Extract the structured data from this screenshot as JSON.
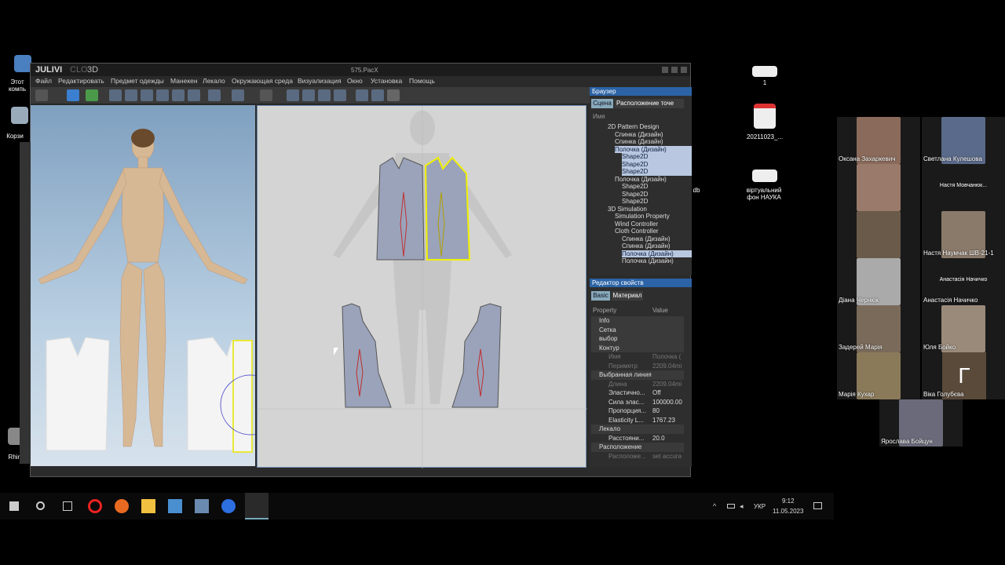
{
  "desktop": {
    "icons_left": [
      {
        "label": "Этот\nкомпь",
        "icon": "computer-icon"
      },
      {
        "label": "Корзи",
        "icon": "recycle-bin-icon"
      },
      {
        "label": "Rhino",
        "icon": "rhino-icon"
      }
    ],
    "icons_right": [
      {
        "label": "1",
        "icon": "file-icon"
      },
      {
        "label": "20211023_...",
        "icon": "pdf-icon"
      },
      {
        "label": "віртуальний\nфон НАУКА",
        "icon": "image-icon"
      }
    ],
    "partial_text": "db"
  },
  "app": {
    "logo": "JULIVI",
    "logo_suffix": "3D",
    "title": "575.PacX",
    "menu": [
      "Файл",
      "Редактировать",
      "Предмет одежды",
      "Манекен",
      "Лекало",
      "Окружающая среда",
      "Визуализация",
      "Окно",
      "Установка",
      "Помощь"
    ]
  },
  "browser": {
    "title": "Браузер",
    "tabs": [
      "Сцена",
      "Расположение точе"
    ],
    "header": "Имя",
    "tree": [
      {
        "label": "2D Pattern Design",
        "level": 1,
        "sel": false
      },
      {
        "label": "Спинка (Дизайн)",
        "level": 2,
        "sel": false
      },
      {
        "label": "Спинка (Дизайн)",
        "level": 2,
        "sel": false
      },
      {
        "label": "Полочка (Дизайн)",
        "level": 2,
        "sel": true
      },
      {
        "label": "Shape2D",
        "level": 3,
        "sel": true
      },
      {
        "label": "Shape2D",
        "level": 3,
        "sel": true
      },
      {
        "label": "Shape2D",
        "level": 3,
        "sel": true
      },
      {
        "label": "Полочка (Дизайн)",
        "level": 2,
        "sel": false
      },
      {
        "label": "Shape2D",
        "level": 3,
        "sel": false
      },
      {
        "label": "Shape2D",
        "level": 3,
        "sel": false
      },
      {
        "label": "Shape2D",
        "level": 3,
        "sel": false
      },
      {
        "label": "3D Simulation",
        "level": 1,
        "sel": false
      },
      {
        "label": "Simulation Property",
        "level": 2,
        "sel": false
      },
      {
        "label": "Wind Controller",
        "level": 2,
        "sel": false
      },
      {
        "label": "Cloth Controller",
        "level": 2,
        "sel": false
      },
      {
        "label": "Спинка (Дизайн)",
        "level": 3,
        "sel": false
      },
      {
        "label": "Спинка (Дизайн)",
        "level": 3,
        "sel": false
      },
      {
        "label": "Полочка (Дизайн)",
        "level": 3,
        "sel": true
      },
      {
        "label": "Полочка (Дизайн)",
        "level": 3,
        "sel": false
      }
    ]
  },
  "props": {
    "title": "Редактор свойств",
    "tabs": [
      "Basic",
      "Материал"
    ],
    "col_property": "Property",
    "col_value": "Value",
    "rows": [
      {
        "k": "Info",
        "v": "",
        "type": "grp"
      },
      {
        "k": "Сетка",
        "v": "",
        "type": "grp"
      },
      {
        "k": "выбор",
        "v": "",
        "type": "grp"
      },
      {
        "k": "Контур",
        "v": "",
        "type": "grp"
      },
      {
        "k": "Имя",
        "v": "Полочка (",
        "type": "dim"
      },
      {
        "k": "Периметр",
        "v": "2209.04mi",
        "type": "dim"
      },
      {
        "k": "Выбранная линия",
        "v": "",
        "type": "grp"
      },
      {
        "k": "Длина",
        "v": "2209.04mi",
        "type": "dim"
      },
      {
        "k": "Эластично...",
        "v": "Off",
        "type": "val"
      },
      {
        "k": "Сила элас...",
        "v": "100000.00",
        "type": "val"
      },
      {
        "k": "Пропорция...",
        "v": "80",
        "type": "val"
      },
      {
        "k": "Elasticity L...",
        "v": "1767.23",
        "type": "val"
      },
      {
        "k": "Лекало",
        "v": "",
        "type": "grp"
      },
      {
        "k": "Расстояни...",
        "v": "20.0",
        "type": "val"
      },
      {
        "k": "Расположение",
        "v": "",
        "type": "grp"
      },
      {
        "k": "Расположе...",
        "v": "set accura",
        "type": "dim"
      }
    ]
  },
  "participants": [
    {
      "name": "Оксана Захаркевич",
      "photo": true
    },
    {
      "name": "Светлана Кулешова",
      "photo": true
    },
    {
      "name": "",
      "photo": true
    },
    {
      "name": "",
      "center": "Настя Мовчанюк...",
      "photo": false
    },
    {
      "name": "",
      "photo": true
    },
    {
      "name": "Настя Наумчак ШВ-21-1",
      "photo": true
    },
    {
      "name": "Діана Чернюк",
      "photo": true
    },
    {
      "name": "Анастасія Начичко",
      "center": "Анастасія Начичко",
      "photo": false
    },
    {
      "name": "Задерей Марія",
      "photo": true
    },
    {
      "name": "Юля Бойко",
      "photo": true
    },
    {
      "name": "Марія Кухар",
      "photo": true
    },
    {
      "name": "Віка Голубєва",
      "letter": "Г",
      "photo": false
    },
    {
      "name": "Ярослава Бойцун",
      "photo": true
    }
  ],
  "taskbar": {
    "lang": "УКР",
    "time": "9:12",
    "date": "11.05.2023"
  },
  "colors": {
    "accent": "#2b63a6",
    "selected_outline": "#f0f000",
    "pattern_fill": "#9aa3ba"
  }
}
